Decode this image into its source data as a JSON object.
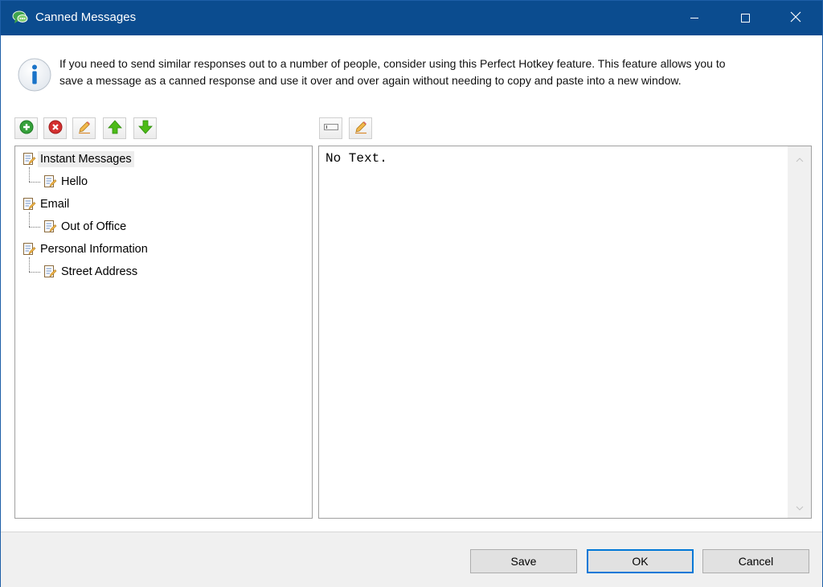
{
  "window": {
    "title": "Canned Messages",
    "icon": "chat-bubble-icon",
    "controls": [
      "minimize-icon",
      "maximize-icon",
      "close-icon"
    ]
  },
  "info": {
    "icon": "info-icon",
    "line1": "If you need to send similar responses out to a number of people, consider using this Perfect Hotkey feature. This feature allows you to",
    "line2": "save a message as a canned response and use it over and over again without needing to copy and paste into a new window."
  },
  "tree_toolbar": [
    "add-icon",
    "delete-icon",
    "edit-icon",
    "move-up-icon",
    "move-down-icon"
  ],
  "text_toolbar": [
    "rename-icon",
    "edit-icon"
  ],
  "tree": {
    "items": [
      {
        "label": "Instant Messages",
        "level": 0,
        "selected": true
      },
      {
        "label": "Hello",
        "level": 1
      },
      {
        "label": "Email",
        "level": 0
      },
      {
        "label": "Out of Office",
        "level": 1
      },
      {
        "label": "Personal Information",
        "level": 0
      },
      {
        "label": "Street Address",
        "level": 1
      }
    ]
  },
  "editor": {
    "text": "No Text."
  },
  "buttons": {
    "save": "Save",
    "ok": "OK",
    "cancel": "Cancel"
  },
  "colors": {
    "titlebar": "#0b4c8f",
    "accent": "#0078d7",
    "footer": "#f0f0f0"
  }
}
